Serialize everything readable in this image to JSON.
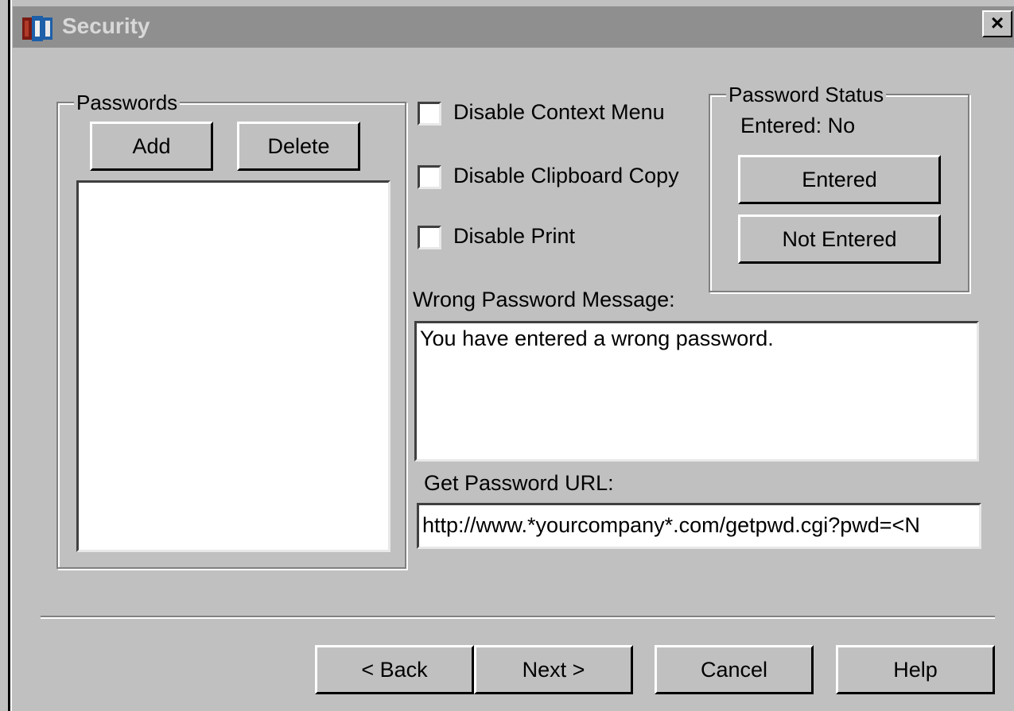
{
  "window": {
    "title": "Security",
    "close_label": "×"
  },
  "passwords_group": {
    "legend": "Passwords",
    "add_label": "Add",
    "delete_label": "Delete",
    "items": []
  },
  "options": {
    "disable_context_menu": {
      "label": "Disable Context Menu",
      "checked": false
    },
    "disable_clipboard_copy": {
      "label": "Disable Clipboard Copy",
      "checked": false
    },
    "disable_print": {
      "label": "Disable Print",
      "checked": false
    }
  },
  "password_status": {
    "legend": "Password Status",
    "status_text": "Entered: No",
    "entered_label": "Entered",
    "not_entered_label": "Not Entered"
  },
  "wrong_password": {
    "label": "Wrong Password Message:",
    "value": "You have entered a wrong password."
  },
  "get_password_url": {
    "label": "Get Password URL:",
    "value": "http://www.*yourcompany*.com/getpwd.cgi?pwd=<N"
  },
  "footer": {
    "back_label": "< Back",
    "next_label": "Next >",
    "cancel_label": "Cancel",
    "help_label": "Help"
  }
}
